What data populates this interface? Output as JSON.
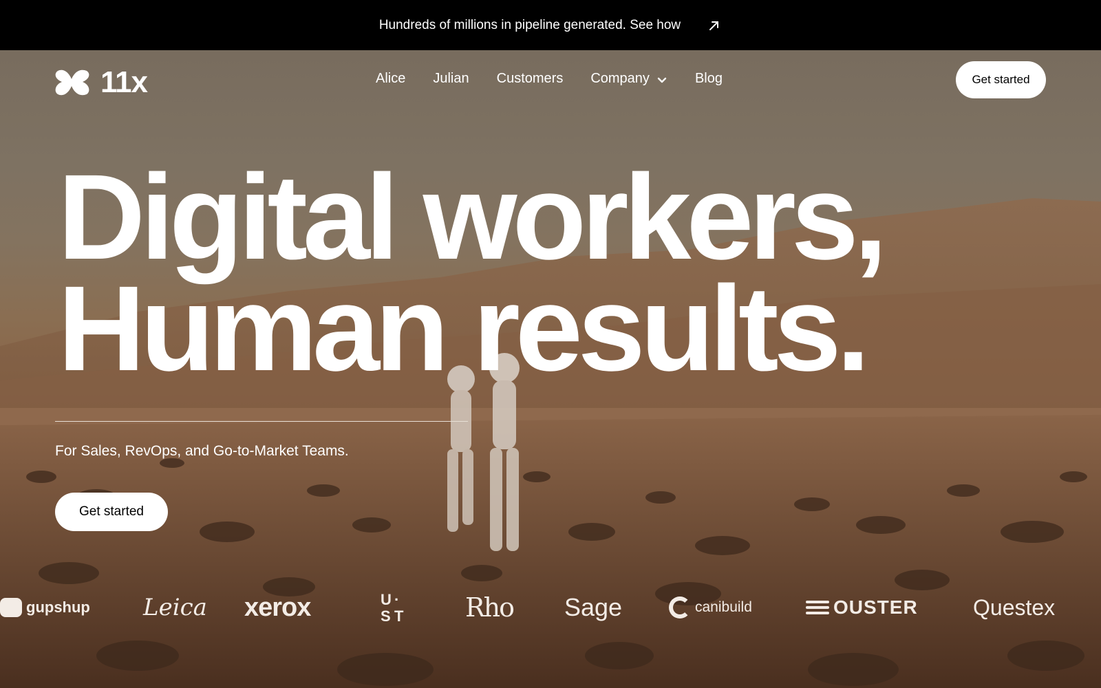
{
  "announcement": {
    "text": "Hundreds of millions in pipeline generated. See how",
    "icon": "arrow-up-right-icon"
  },
  "brand": {
    "name": "11x",
    "icon": "11x-logo-icon"
  },
  "nav": {
    "items": [
      {
        "label": "Alice"
      },
      {
        "label": "Julian"
      },
      {
        "label": "Customers"
      },
      {
        "label": "Company",
        "icon": "chevron-down-icon"
      },
      {
        "label": "Blog"
      }
    ],
    "cta": "Get started"
  },
  "hero": {
    "headline_line1": "Digital workers,",
    "headline_line2": "Human results.",
    "subtitle": "For Sales, RevOps, and Go-to-Market Teams.",
    "cta": "Get started"
  },
  "customer_logos": [
    "gupshup",
    "Leica",
    "xerox",
    "UST",
    "Rho",
    "Sage",
    "canibuild",
    "OUSTER",
    "Questex"
  ],
  "colors": {
    "announcement_bg": "#000000",
    "text": "#ffffff",
    "button_bg": "#ffffff",
    "button_text": "#000000",
    "hero_tint": "#8a6548"
  }
}
